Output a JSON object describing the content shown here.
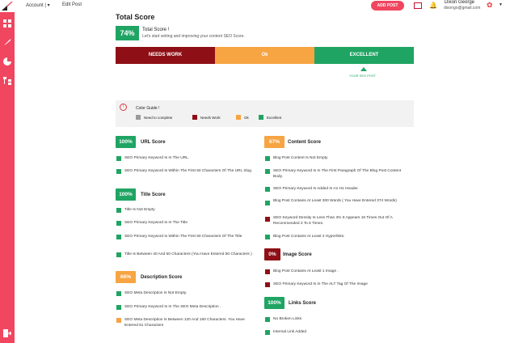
{
  "topbar": {
    "account_label": "Account | ▾",
    "page_label": "Edit Post",
    "add_post_label": "ADD POST",
    "user_name": "Dixon George",
    "user_email": "dixongo@gmail.com"
  },
  "total": {
    "heading": "Total Score",
    "percent": "74%",
    "label": "Total Score !",
    "subtitle": "Let's start writing and improving your content SEO Score.",
    "bar_needs_work": "NEEDS WORK",
    "bar_ok": "Ok",
    "bar_excellent": "EXCELLENT",
    "needle_label": "YOUR SEO POST"
  },
  "guide": {
    "title": "Color Guide !",
    "need": "Need to complete",
    "needs_work": "Needs Work",
    "ok": "Ok",
    "excellent": "Excellent"
  },
  "url": {
    "score": "100%",
    "title": "URL Score",
    "items": [
      "SEO Primary Keyword Is In The URL.",
      "SEO Primary Keyword Is Within The First 50 Characters Of The URL Slug"
    ]
  },
  "title_s": {
    "score": "100%",
    "title": "Title Score",
    "items": [
      "Title Is Not Empty",
      "SEO Primary Keyword Is In The Title",
      "SEO Primary Keyword Is Within The First 50 Characters Of The Title",
      "Title Is Between 40 And 60 Characters (You Have Entered 50 Characters )"
    ]
  },
  "desc": {
    "score": "66%",
    "title": "Description Score",
    "items": [
      "SEO Meta Description Is Not Empty.",
      "SEO Primary Keyword Is In The SEO Meta Description .",
      "SEO Meta Description Is Between 120 And 160 Characters. You Have Entered 61 Characters"
    ]
  },
  "content": {
    "score": "67%",
    "title": "Content Score",
    "items": [
      "Blog Post Content Is Not Empty",
      "SEO Primary Keyword Is In The First Paragraph Of The Blog Post Content Body.",
      "SEO Primary Keyword Is Added In An H1 Header.",
      "Blog Post Contains At Least 300 Words ( You Have Entered 374 Words)",
      "SEO Keyword Density Is Less Than 3% It Appears 16 Times Out Of A Recommended 3 To 6 Times.",
      "Blog Post Contains At Least 2 Hyperlinks."
    ]
  },
  "image": {
    "score": "0%",
    "title": "Image Score",
    "items": [
      "Blog Post Contains At Least 1 Image .",
      "SEO Primary Keyword Is In The ALT Tag Of The Image"
    ]
  },
  "links": {
    "score": "100%",
    "title": "Links Score",
    "items": [
      "No Broken Links",
      "Internal Link Added"
    ]
  },
  "colors": {
    "brand": "#f0465f",
    "green": "#1fa463",
    "orange": "#f7a443",
    "red": "#8e1016",
    "grey": "#9a9a9a"
  }
}
